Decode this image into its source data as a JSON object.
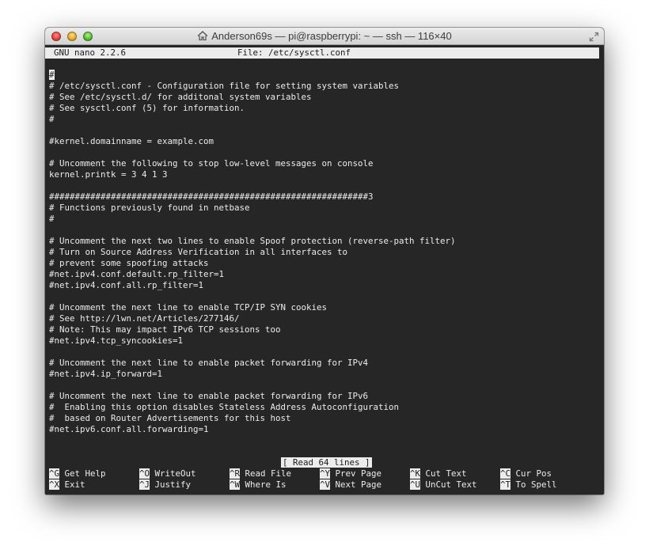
{
  "window": {
    "title": "Anderson69s — pi@raspberrypi: ~ — ssh — 116×40"
  },
  "nano": {
    "version": "GNU nano 2.2.6",
    "file_label": "File: /etc/sysctl.conf"
  },
  "content_lines": [
    "",
    "#",
    "# /etc/sysctl.conf - Configuration file for setting system variables",
    "# See /etc/sysctl.d/ for additonal system variables",
    "# See sysctl.conf (5) for information.",
    "#",
    "",
    "#kernel.domainname = example.com",
    "",
    "# Uncomment the following to stop low-level messages on console",
    "kernel.printk = 3 4 1 3",
    "",
    "##############################################################3",
    "# Functions previously found in netbase",
    "#",
    "",
    "# Uncomment the next two lines to enable Spoof protection (reverse-path filter)",
    "# Turn on Source Address Verification in all interfaces to",
    "# prevent some spoofing attacks",
    "#net.ipv4.conf.default.rp_filter=1",
    "#net.ipv4.conf.all.rp_filter=1",
    "",
    "# Uncomment the next line to enable TCP/IP SYN cookies",
    "# See http://lwn.net/Articles/277146/",
    "# Note: This may impact IPv6 TCP sessions too",
    "#net.ipv4.tcp_syncookies=1",
    "",
    "# Uncomment the next line to enable packet forwarding for IPv4",
    "#net.ipv4.ip_forward=1",
    "",
    "# Uncomment the next line to enable packet forwarding for IPv6",
    "#  Enabling this option disables Stateless Address Autoconfiguration",
    "#  based on Router Advertisements for this host",
    "#net.ipv6.conf.all.forwarding=1"
  ],
  "status_message": "[ Read 64 lines ]",
  "shortcuts": [
    {
      "key": "^G",
      "label": "Get Help"
    },
    {
      "key": "^O",
      "label": "WriteOut"
    },
    {
      "key": "^R",
      "label": "Read File"
    },
    {
      "key": "^Y",
      "label": "Prev Page"
    },
    {
      "key": "^K",
      "label": "Cut Text"
    },
    {
      "key": "^C",
      "label": "Cur Pos"
    },
    {
      "key": "^X",
      "label": "Exit"
    },
    {
      "key": "^J",
      "label": "Justify"
    },
    {
      "key": "^W",
      "label": "Where Is"
    },
    {
      "key": "^V",
      "label": "Next Page"
    },
    {
      "key": "^U",
      "label": "UnCut Text"
    },
    {
      "key": "^T",
      "label": "To Spell"
    }
  ],
  "colors": {
    "terminal_background": "#262626",
    "terminal_text": "#ececec"
  }
}
